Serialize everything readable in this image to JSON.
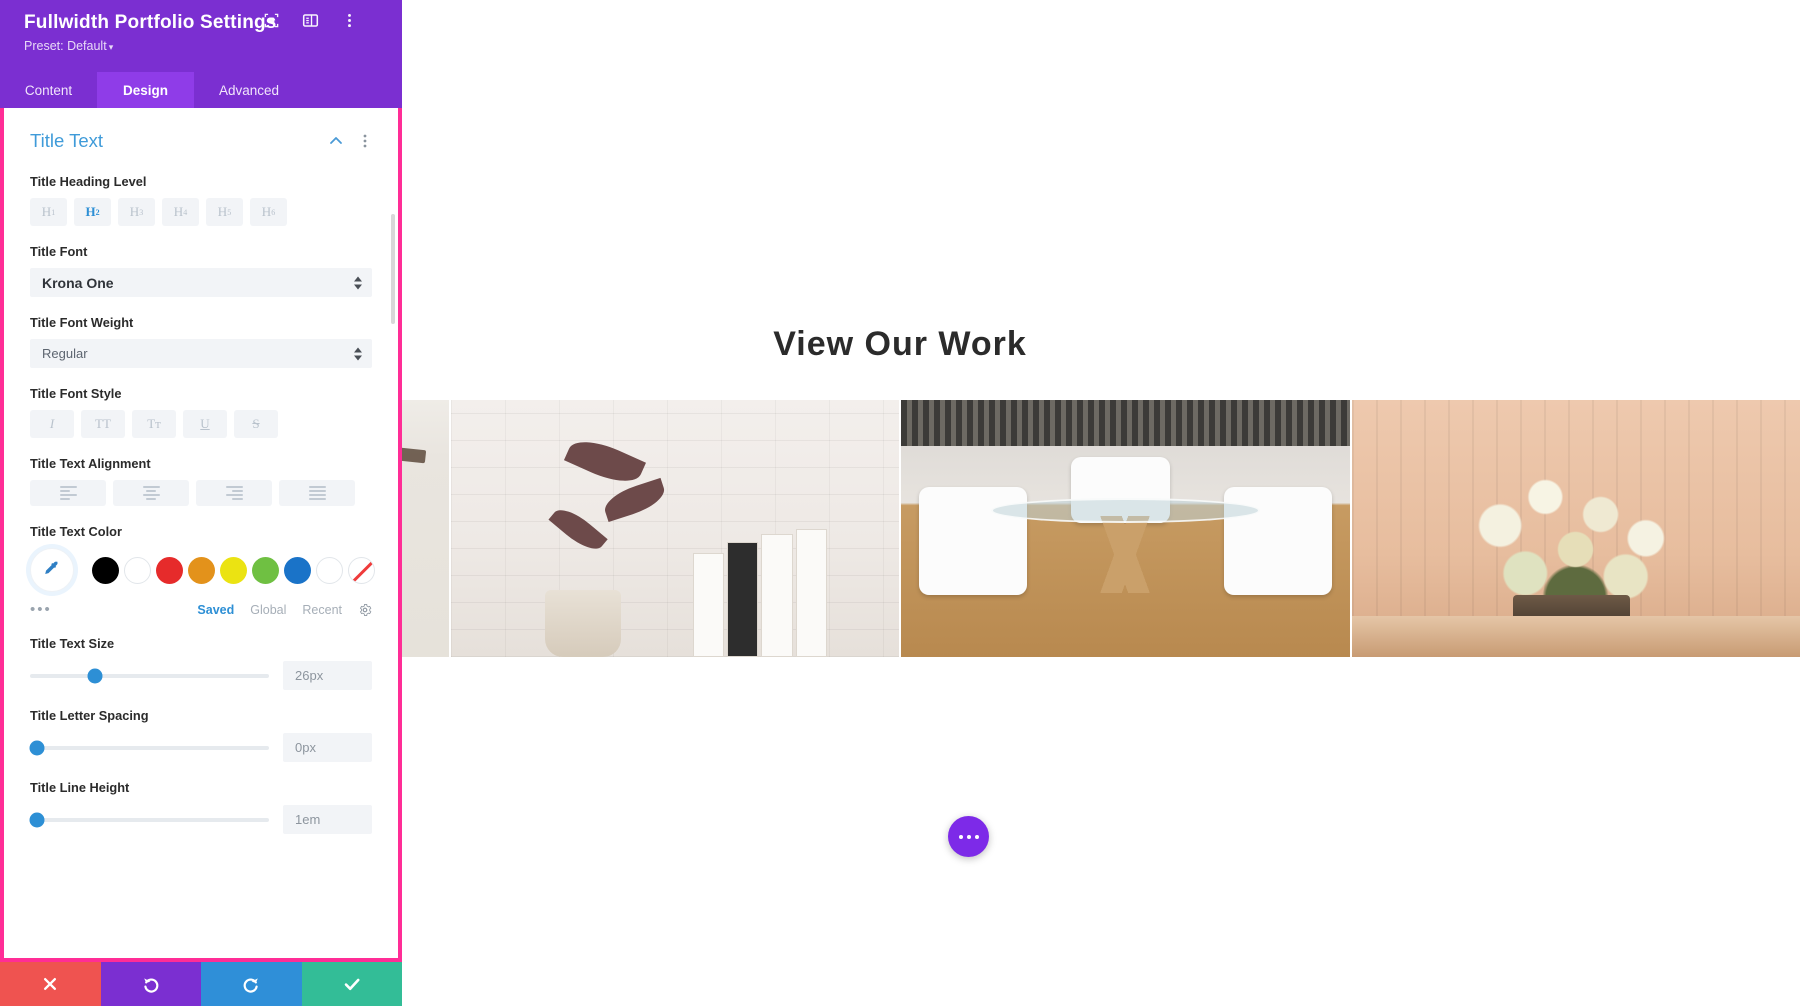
{
  "preview": {
    "heading": "View Our Work",
    "fab_label": "more-options",
    "portfolio_items": [
      {
        "name": "white-loft-interior"
      },
      {
        "name": "brick-wall-plant-books"
      },
      {
        "name": "glass-dining-table-chairs"
      },
      {
        "name": "flower-bouquet-curtains"
      }
    ]
  },
  "modal": {
    "title": "Fullwidth Portfolio Settings",
    "preset_label": "Preset: Default",
    "preset_caret": "▾",
    "header_icons": [
      "responsive-view-icon",
      "layout-panel-icon",
      "kebab-menu-icon"
    ],
    "tabs": [
      {
        "label": "Content",
        "active": false
      },
      {
        "label": "Design",
        "active": true
      },
      {
        "label": "Advanced",
        "active": false
      }
    ],
    "section": {
      "title": "Title Text",
      "collapse_icon": "chevron-up-icon",
      "menu_icon": "kebab-menu-icon"
    },
    "fields": {
      "heading_level": {
        "label": "Title Heading Level",
        "options": [
          "H1",
          "H2",
          "H3",
          "H4",
          "H5",
          "H6"
        ],
        "selected": "H2"
      },
      "font": {
        "label": "Title Font",
        "value": "Krona One"
      },
      "font_weight": {
        "label": "Title Font Weight",
        "value": "Regular"
      },
      "font_style": {
        "label": "Title Font Style",
        "options": [
          "I",
          "TT",
          "Tт",
          "U",
          "S"
        ],
        "selected": null
      },
      "text_alignment": {
        "label": "Title Text Alignment",
        "options": [
          "left",
          "center",
          "right",
          "justify"
        ],
        "selected": null
      },
      "text_color": {
        "label": "Title Text Color",
        "eyedropper": "eyedropper-icon",
        "swatches": [
          "#000000",
          "#ffffff",
          "#e62b2b",
          "#e3921b",
          "#ebe312",
          "#6fc042",
          "#1a73c8",
          "#ffffff",
          "none"
        ],
        "more_label": "•••",
        "tabs": [
          {
            "label": "Saved",
            "active": true
          },
          {
            "label": "Global",
            "active": false
          },
          {
            "label": "Recent",
            "active": false
          }
        ],
        "settings_icon": "gear-icon"
      },
      "text_size": {
        "label": "Title Text Size",
        "value": "26px",
        "knob_percent": 27
      },
      "letter_spacing": {
        "label": "Title Letter Spacing",
        "value": "0px",
        "knob_percent": 3
      },
      "line_height": {
        "label": "Title Line Height",
        "value": "1em",
        "knob_percent": 3
      }
    },
    "footer": {
      "cancel": "close-icon",
      "undo": "undo-icon",
      "redo": "redo-icon",
      "save": "checkmark-icon"
    }
  }
}
